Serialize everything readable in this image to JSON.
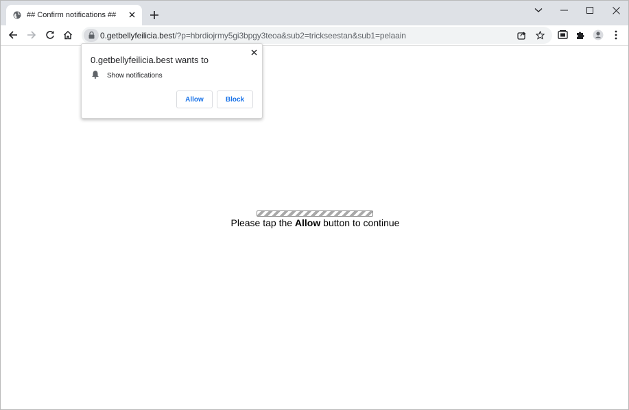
{
  "tab": {
    "title": "## Confirm notifications ##"
  },
  "address_bar": {
    "host": "0.getbellyfeilicia.best",
    "path": "/?p=hbrdiojrmy5gi3bpgy3teoa&sub2=trickseestan&sub1=pelaain"
  },
  "popup": {
    "title": "0.getbellyfeilicia.best wants to",
    "permission": "Show notifications",
    "allow_label": "Allow",
    "block_label": "Block"
  },
  "page": {
    "message_before": "Please tap the ",
    "message_bold": "Allow",
    "message_after": " button to continue"
  },
  "icons": {
    "favicon": "globe-icon",
    "tab_close": "close-icon",
    "new_tab": "plus-icon",
    "back": "arrow-left-icon",
    "forward": "arrow-right-icon",
    "reload": "reload-icon",
    "home": "home-icon",
    "lock": "lock-icon",
    "share": "share-icon",
    "bookmark": "star-icon",
    "media": "media-control-icon",
    "extensions": "puzzle-icon",
    "profile": "account-icon",
    "menu": "kebab-menu-icon",
    "bell": "bell-icon"
  },
  "colors": {
    "accent": "#1a73e8",
    "tabstrip": "#dee1e6",
    "omnibox": "#f1f3f4"
  }
}
